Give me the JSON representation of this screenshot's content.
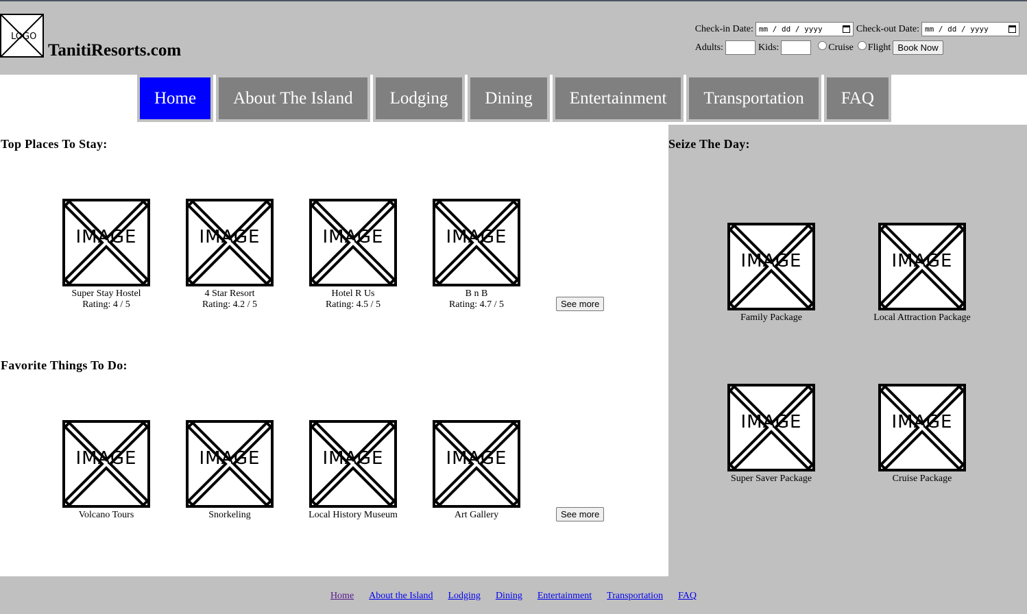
{
  "header": {
    "logo_text": "LOGO",
    "site_title": "TanitiResorts.com",
    "booking": {
      "checkin_label": "Check-in Date:",
      "checkin_placeholder": "mm / dd / yyyy",
      "checkout_label": "Check-out Date:",
      "checkout_placeholder": "mm / dd / yyyy",
      "adults_label": "Adults:",
      "kids_label": "Kids:",
      "cruise_label": "Cruise",
      "flight_label": "Flight",
      "book_label": "Book Now"
    }
  },
  "nav": {
    "items": [
      {
        "label": "Home"
      },
      {
        "label": "About The Island"
      },
      {
        "label": "Lodging"
      },
      {
        "label": "Dining"
      },
      {
        "label": "Entertainment"
      },
      {
        "label": "Transportation"
      },
      {
        "label": "FAQ"
      }
    ]
  },
  "placeholder_text": "IMAGE",
  "stays": {
    "heading": "Top Places To Stay:",
    "items": [
      {
        "name": "Super Stay Hostel",
        "rating": "Rating: 4 / 5"
      },
      {
        "name": "4 Star Resort",
        "rating": "Rating: 4.2 / 5"
      },
      {
        "name": "Hotel R Us",
        "rating": "Rating: 4.5 / 5"
      },
      {
        "name": "B n B",
        "rating": "Rating: 4.7 / 5"
      }
    ],
    "see_more": "See more"
  },
  "things": {
    "heading": "Favorite Things To Do:",
    "items": [
      {
        "name": "Volcano Tours"
      },
      {
        "name": "Snorkeling"
      },
      {
        "name": "Local History Museum"
      },
      {
        "name": "Art Gallery"
      }
    ],
    "see_more": "See more"
  },
  "packages": {
    "heading": "Seize The Day:",
    "items": [
      {
        "name": "Family Package"
      },
      {
        "name": "Local Attraction Package"
      },
      {
        "name": "Super Saver Package"
      },
      {
        "name": "Cruise Package"
      }
    ]
  },
  "footer": {
    "links": [
      {
        "label": "Home"
      },
      {
        "label": "About the Island"
      },
      {
        "label": "Lodging"
      },
      {
        "label": "Dining"
      },
      {
        "label": "Entertainment"
      },
      {
        "label": "Transportation"
      },
      {
        "label": "FAQ"
      }
    ]
  },
  "colors": {
    "header_bg": "#c0c0c0",
    "nav_active": "#0000ff",
    "nav_inactive": "#808080",
    "link": "#0000ee",
    "link_visited": "#551a8b"
  }
}
